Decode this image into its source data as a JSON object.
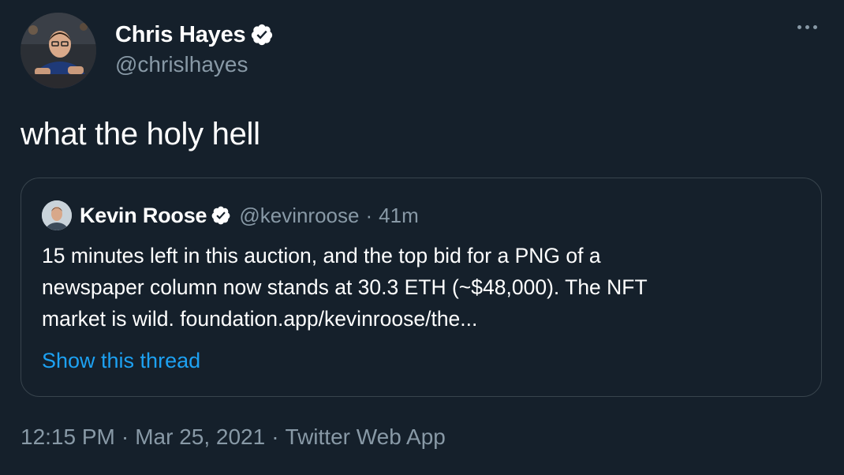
{
  "author": {
    "display_name": "Chris Hayes",
    "handle": "@chrislhayes",
    "verified_icon": "verified-badge-icon"
  },
  "more_icon": "more-options-icon",
  "tweet": {
    "text": "what the holy hell"
  },
  "quoted_tweet": {
    "display_name": "Kevin Roose",
    "handle": "@kevinroose",
    "separator": "·",
    "time": "41m",
    "text_lines": [
      "15 minutes left in this auction, and the top bid for a PNG of a",
      "newspaper column now stands at 30.3 ETH (~$48,000). The NFT",
      "market is wild. foundation.app/kevinroose/the..."
    ],
    "show_thread": "Show this thread"
  },
  "meta": {
    "time": "12:15 PM",
    "separator": "·",
    "date": "Mar 25, 2021",
    "source": "Twitter Web App"
  },
  "colors": {
    "background": "#15202b",
    "secondary_text": "#8899a6",
    "link": "#1da1f2",
    "border": "#38444d"
  }
}
